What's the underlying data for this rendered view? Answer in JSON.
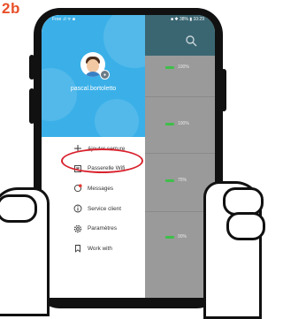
{
  "step_label": "2b",
  "statusbar": {
    "left": "Free .ıl ᯤ ■",
    "right": "■ ✱ 38% ▮ 10:29"
  },
  "drawer": {
    "username": "pascal.bortoletto",
    "menu": [
      {
        "label": "Ajouter serrure",
        "icon": "plus-icon"
      },
      {
        "label": "Passerelle Wifi",
        "icon": "gateway-icon"
      },
      {
        "label": "Messages",
        "icon": "messages-icon"
      },
      {
        "label": "Service client",
        "icon": "info-icon"
      },
      {
        "label": "Paramètres",
        "icon": "gear-icon"
      },
      {
        "label": "Work with",
        "icon": "bookmark-icon"
      }
    ]
  },
  "background_list": {
    "rows": [
      {
        "battery": "100%"
      },
      {
        "battery": "100%"
      },
      {
        "battery": "75%"
      },
      {
        "battery": "90%"
      }
    ]
  },
  "colors": {
    "header_blue": "#3bb0e8",
    "highlight_red": "#d9232e",
    "step_orange": "#e8502a"
  }
}
